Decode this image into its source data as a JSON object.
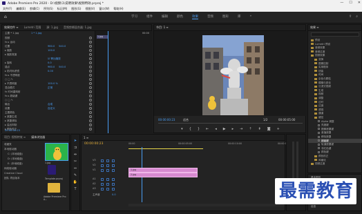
{
  "titlebar": {
    "title": "Adobe Premiere Pro 2020 - D:\\视频\\1\\说明效果\\视频特效.prproj *",
    "min": "—",
    "max": "☐",
    "close": "✕"
  },
  "menubar": {
    "items": [
      "文件(F)",
      "编辑(E)",
      "剪辑(C)",
      "序列(S)",
      "标记(M)",
      "图形(G)",
      "视图(V)",
      "窗口(W)",
      "帮助(H)"
    ]
  },
  "workspace": {
    "tabs": [
      "学习",
      "组件",
      "编辑",
      "颜色",
      "效果",
      "音频",
      "图形",
      "库"
    ],
    "active": "效果",
    "more": "»"
  },
  "effect_controls": {
    "tabs": [
      "效果控件 ≡",
      "Lumetri 范围",
      "源: 1.jpg",
      "音频剪辑混合器: 1.jpg"
    ],
    "source": "主要 * 1.jpg",
    "seq": "1 * 1.jpg",
    "timecode_end": "00:00",
    "clip": "1.jpg",
    "rows": [
      {
        "label": "视频",
        "v": "",
        "v2": ""
      },
      {
        "label": "fx ▸ 运动",
        "v": "",
        "v2": ""
      },
      {
        "label": "位置",
        "v": "960.0",
        "v2": "540.0"
      },
      {
        "label": "▸ 缩放",
        "v": "100.0",
        "v2": ""
      },
      {
        "label": "▸ 缩放宽度",
        "v": "",
        "v2": ""
      },
      {
        "label": "",
        "v": "☑ 等比缩放",
        "v2": ""
      },
      {
        "label": "▸ 旋转",
        "v": "0.0",
        "v2": ""
      },
      {
        "label": "锚点",
        "v": "960.0",
        "v2": "540.0"
      },
      {
        "label": "▸ 防闪烁滤镜",
        "v": "0.00",
        "v2": ""
      },
      {
        "label": "fx ▸ 不透明度",
        "v": "",
        "v2": ""
      },
      {
        "label": "○ □ ✎",
        "v": "",
        "v2": ""
      },
      {
        "label": "▸ 不透明度",
        "v": "100.0 %",
        "v2": ""
      },
      {
        "label": "混合模式",
        "v": "正常",
        "v2": ""
      },
      {
        "label": "fx 时间重映射",
        "v": "",
        "v2": ""
      },
      {
        "label": "fx ▸ 超级键",
        "v": "",
        "v2": ""
      },
      {
        "label": "○ □ ✎",
        "v": "",
        "v2": ""
      },
      {
        "label": "输出",
        "v": "合成",
        "v2": ""
      },
      {
        "label": "设置",
        "v": "自定义",
        "v2": ""
      },
      {
        "label": "主要颜色",
        "v": "",
        "v2": ""
      },
      {
        "label": "▸ 遮罩生成",
        "v": "",
        "v2": ""
      },
      {
        "label": "▸ 遮罩清除",
        "v": "",
        "v2": ""
      },
      {
        "label": "▸ 溢出抑制",
        "v": "",
        "v2": ""
      },
      {
        "label": "▸ 颜色校正",
        "v": "",
        "v2": ""
      }
    ],
    "footer_tc": "00:00:00:23"
  },
  "program": {
    "tab": "节目: 1 ≡",
    "timecode": "00:00:00:23",
    "fit": "适合",
    "quality": "1/2",
    "duration": "00:00:05:00"
  },
  "effects": {
    "tab": "效果 ≡",
    "items": [
      {
        "t": "预设",
        "d": 0,
        "f": true
      },
      {
        "t": "Lumetri 预设",
        "d": 0,
        "f": true
      },
      {
        "t": "音频效果",
        "d": 0,
        "f": true
      },
      {
        "t": "音频过渡",
        "d": 0,
        "f": true
      },
      {
        "t": "视频效果",
        "d": 0,
        "f": true
      },
      {
        "t": "变换",
        "d": 1,
        "f": true
      },
      {
        "t": "图像控制",
        "d": 1,
        "f": true
      },
      {
        "t": "实用程序",
        "d": 1,
        "f": true
      },
      {
        "t": "扭曲",
        "d": 1,
        "f": true
      },
      {
        "t": "时间",
        "d": 1,
        "f": true
      },
      {
        "t": "杂色与颗粒",
        "d": 1,
        "f": true
      },
      {
        "t": "模糊与锐化",
        "d": 1,
        "f": true
      },
      {
        "t": "沉浸式视频",
        "d": 1,
        "f": true
      },
      {
        "t": "生成",
        "d": 1,
        "f": true
      },
      {
        "t": "视频",
        "d": 1,
        "f": true
      },
      {
        "t": "调整",
        "d": 1,
        "f": true
      },
      {
        "t": "过时",
        "d": 1,
        "f": true
      },
      {
        "t": "过渡",
        "d": 1,
        "f": true
      },
      {
        "t": "透视",
        "d": 1,
        "f": true
      },
      {
        "t": "通道",
        "d": 1,
        "f": true
      },
      {
        "t": "键控",
        "d": 1,
        "f": true
      },
      {
        "t": "Alpha 调整",
        "d": 2,
        "f": false
      },
      {
        "t": "亮度键",
        "d": 2,
        "f": false
      },
      {
        "t": "图像遮罩键",
        "d": 2,
        "f": false
      },
      {
        "t": "差值遮罩",
        "d": 2,
        "f": false
      },
      {
        "t": "移除遮罩",
        "d": 2,
        "f": false
      },
      {
        "t": "超级键",
        "d": 2,
        "f": false,
        "sel": true
      },
      {
        "t": "轨道遮罩键",
        "d": 2,
        "f": false
      },
      {
        "t": "非红色键",
        "d": 2,
        "f": false
      },
      {
        "t": "颜色键",
        "d": 2,
        "f": false
      },
      {
        "t": "颜色校正",
        "d": 1,
        "f": true
      },
      {
        "t": "风格化",
        "d": 1,
        "f": true
      },
      {
        "t": "视频过渡",
        "d": 0,
        "f": true
      }
    ],
    "lower": [
      "基本图形",
      "基本声音",
      "Lumetri 颜色",
      "库",
      "标记",
      "历史记录",
      "信息"
    ]
  },
  "project": {
    "tabs": [
      "项目: 视频特效 ≡",
      "媒体浏览器"
    ],
    "media_tabs": [
      "收藏夹",
      "本地驱动器"
    ],
    "drives": [
      "C: (本地磁盘)",
      "D: (本地磁盘)",
      "E: (本地磁盘)"
    ],
    "network": [
      "网络驱动器",
      "Creative Cloud",
      "团队 项目版本"
    ],
    "items": [
      {
        "name": "1.jpg",
        "meta": "5:00"
      },
      {
        "name": "Template.prproj",
        "meta": ""
      },
      {
        "name": "Adobe Premiere Pro A...",
        "meta": ""
      }
    ]
  },
  "timeline": {
    "tab": "1 ≡",
    "timecode": "00:00:00:23",
    "ruler": [
      "00:00",
      "00:00:05:00",
      "00:00:10:00",
      "00:00:15:00"
    ],
    "tracks": [
      "V3",
      "V2",
      "V1",
      "A1",
      "A2",
      "A3"
    ],
    "master": "主声道",
    "master_val": "0.0",
    "clips": [
      "1.jpg",
      "2.jpg"
    ]
  },
  "watermark": "最需教育"
}
